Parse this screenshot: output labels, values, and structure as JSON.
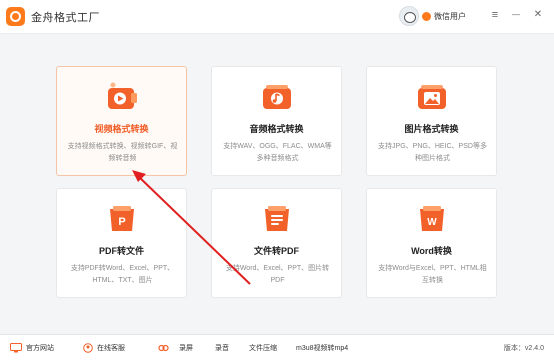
{
  "app": {
    "title": "金舟格式工厂",
    "user_name": "微信用户"
  },
  "window_controls": {
    "menu": "≡",
    "minimize": "—",
    "close": "✕"
  },
  "cards": [
    {
      "title": "视频格式转换",
      "desc": "支持视频格式转换、视频转GIF、视频转音频",
      "icon": "video-icon",
      "active": true
    },
    {
      "title": "音频格式转换",
      "desc": "支持WAV、OGG、FLAC、WMA等多种音频格式",
      "icon": "audio-icon",
      "active": false
    },
    {
      "title": "图片格式转换",
      "desc": "支持JPG、PNG、HEIC、PSD等多种图片格式",
      "icon": "image-icon",
      "active": false
    },
    {
      "title": "PDF转文件",
      "desc": "支持PDF转Word、Excel、PPT、HTML、TXT、图片",
      "icon": "pdf-icon",
      "active": false
    },
    {
      "title": "文件转PDF",
      "desc": "支持Word、Excel、PPT、图片转PDF",
      "icon": "document-icon",
      "active": false
    },
    {
      "title": "Word转换",
      "desc": "支持Word与Excel、PPT、HTML相互转换",
      "icon": "word-icon",
      "active": false
    }
  ],
  "footer": {
    "website": "官方网站",
    "support": "在线客服",
    "record_screen": "录屏",
    "record_audio": "录音",
    "compress": "文件压缩",
    "m3u8": "m3u8视频转mp4",
    "version": "版本：v2.4.0"
  },
  "colors": {
    "accent": "#ef5b25",
    "icon_gradient_top": "#ff8a3d",
    "icon_gradient_bottom": "#f04b22",
    "annotation_arrow": "#e02020"
  }
}
